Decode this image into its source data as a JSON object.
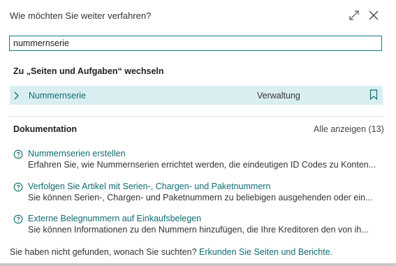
{
  "dialog": {
    "title": "Wie möchten Sie weiter verfahren?"
  },
  "search": {
    "value": "nummernserie"
  },
  "pages_section": {
    "heading": "Zu „Seiten und Aufgaben“ wechseln",
    "results": [
      {
        "name": "Nummernserie",
        "category": "Verwaltung"
      }
    ]
  },
  "documentation": {
    "heading": "Dokumentation",
    "show_all": "Alle anzeigen (13)",
    "items": [
      {
        "title": "Nummernserien erstellen",
        "description": "Erfahren Sie, wie Nummernserien errichtet werden, die eindeutigen ID Codes zu Konten..."
      },
      {
        "title": "Verfolgen Sie Artikel mit Serien-, Chargen- und Paketnummern",
        "description": "Sie können Serien-, Chargen- und Paketnummern zu beliebigen ausgehenden oder ein..."
      },
      {
        "title": "Externe Belegnummern auf Einkaufsbelegen",
        "description": "Sie können Informationen zu den Nummern hinzufügen, die Ihre Kreditoren den von ih..."
      }
    ]
  },
  "footer": {
    "text": "Sie haben nicht gefunden, wonach Sie suchten?",
    "link": "Erkunden Sie Seiten und Berichte."
  },
  "colors": {
    "accent": "#0f6b73",
    "selected_row": "#d9eef0",
    "search_border": "#0f7b84"
  }
}
